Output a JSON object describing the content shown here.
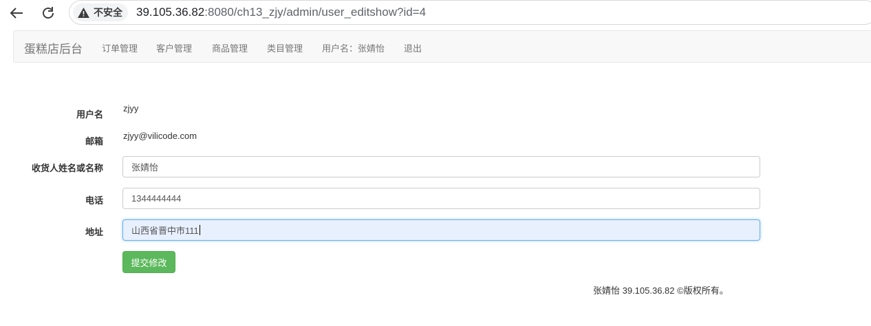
{
  "browser": {
    "security_label": "不安全",
    "url_host": "39.105.36.82",
    "url_path": ":8080/ch13_zjy/admin/user_editshow?id=4",
    "icons": [
      "back-arrow-icon",
      "reload-icon",
      "warning-icon"
    ]
  },
  "navbar": {
    "brand": "蛋糕店后台",
    "links": [
      "订单管理",
      "客户管理",
      "商品管理",
      "类目管理",
      "用户名：张婧怡",
      "退出"
    ]
  },
  "form": {
    "username_label": "用户名",
    "username_value": "zjyy",
    "email_label": "邮箱",
    "email_value": "zjyy@vilicode.com",
    "name_label": "收货人姓名或名称",
    "name_value": "张婧怡",
    "phone_label": "电话",
    "phone_value": "1344444444",
    "address_label": "地址",
    "address_value": "山西省晋中市111",
    "submit_label": "提交修改"
  },
  "footer": {
    "text": "张婧怡 39.105.36.82 ©版权所有。"
  },
  "colors": {
    "submit_button": "#5cb85c",
    "navbar_bg": "#f8f8f8",
    "focused_field_bg": "#e8f0fe"
  }
}
